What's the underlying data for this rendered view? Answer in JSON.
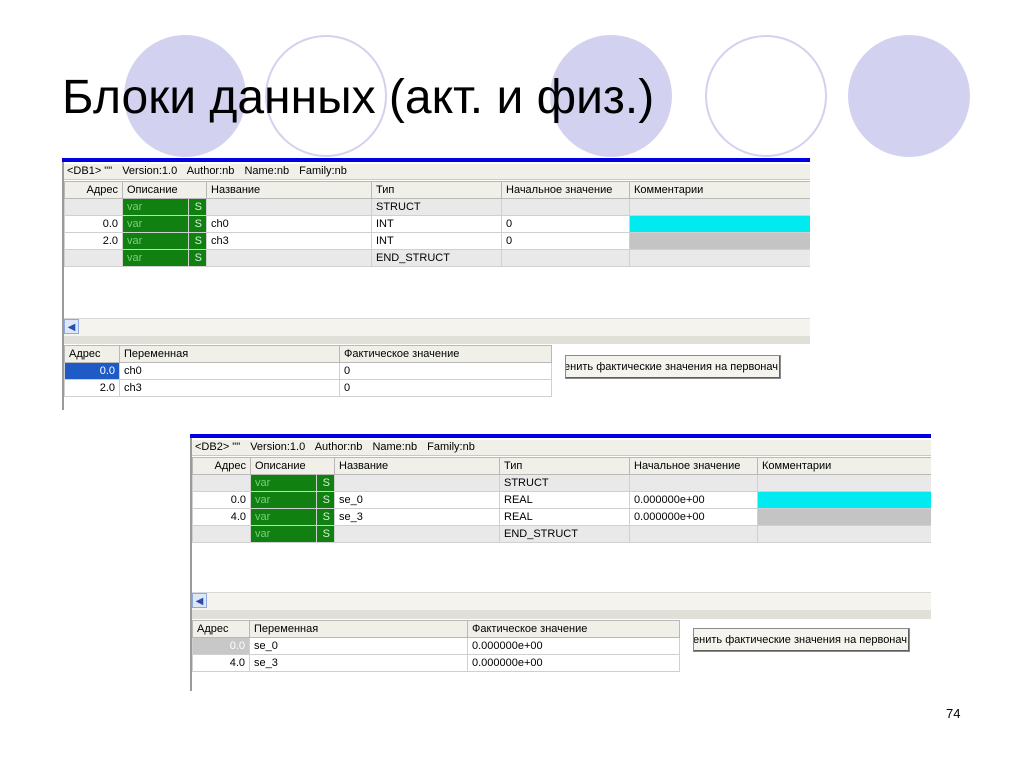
{
  "slide": {
    "title": "Блоки данных (акт. и физ.)",
    "page_number": "74"
  },
  "db1": {
    "header": {
      "name": "<DB1> \"\"",
      "version": "Version:1.0",
      "author": "Author:nb",
      "name_field": "Name:nb",
      "family": "Family:nb"
    },
    "columns": [
      "Адрес",
      "Описание",
      "Название",
      "Тип",
      "Начальное значение",
      "Комментарии"
    ],
    "rows": [
      {
        "addr": "",
        "desc": "var",
        "s": "S",
        "name": "",
        "type": "STRUCT",
        "init": "",
        "comment": ""
      },
      {
        "addr": "0.0",
        "desc": "var",
        "s": "S",
        "name": "ch0",
        "type": "INT",
        "init": "0",
        "comment": ""
      },
      {
        "addr": "2.0",
        "desc": "var",
        "s": "S",
        "name": "ch3",
        "type": "INT",
        "init": "0",
        "comment": ""
      },
      {
        "addr": "",
        "desc": "var",
        "s": "S",
        "name": "",
        "type": "END_STRUCT",
        "init": "",
        "comment": ""
      }
    ],
    "actual_columns": [
      "Адрес",
      "Переменная",
      "Фактическое значение"
    ],
    "actual_rows": [
      {
        "addr": "0.0",
        "var": "ch0",
        "value": "0"
      },
      {
        "addr": "2.0",
        "var": "ch3",
        "value": "0"
      }
    ],
    "apply_button": "Применить фактические значения на первонач"
  },
  "db2": {
    "header": {
      "name": "<DB2> \"\"",
      "version": "Version:1.0",
      "author": "Author:nb",
      "name_field": "Name:nb",
      "family": "Family:nb"
    },
    "columns": [
      "Адрес",
      "Описание",
      "Название",
      "Тип",
      "Начальное значение",
      "Комментарии"
    ],
    "rows": [
      {
        "addr": "",
        "desc": "var",
        "s": "S",
        "name": "",
        "type": "STRUCT",
        "init": "",
        "comment": ""
      },
      {
        "addr": "0.0",
        "desc": "var",
        "s": "S",
        "name": "se_0",
        "type": "REAL",
        "init": "0.000000e+00",
        "comment": ""
      },
      {
        "addr": "4.0",
        "desc": "var",
        "s": "S",
        "name": "se_3",
        "type": "REAL",
        "init": "0.000000e+00",
        "comment": ""
      },
      {
        "addr": "",
        "desc": "var",
        "s": "S",
        "name": "",
        "type": "END_STRUCT",
        "init": "",
        "comment": ""
      }
    ],
    "actual_columns": [
      "Адрес",
      "Переменная",
      "Фактическое значение"
    ],
    "actual_rows": [
      {
        "addr": "0.0",
        "var": "se_0",
        "value": "0.000000e+00"
      },
      {
        "addr": "4.0",
        "var": "se_3",
        "value": "0.000000e+00"
      }
    ],
    "apply_button": "Применить фактические значения на первонач"
  },
  "icons": {
    "scroll_left": "scroll-left-arrow-icon"
  },
  "colors": {
    "decor_circle": "#d2d2f0",
    "var_cell": "#108010",
    "comment_cyan": "#00eaf0",
    "title_bar_blue": "#0000e0",
    "selection": "#1f5bc6"
  }
}
